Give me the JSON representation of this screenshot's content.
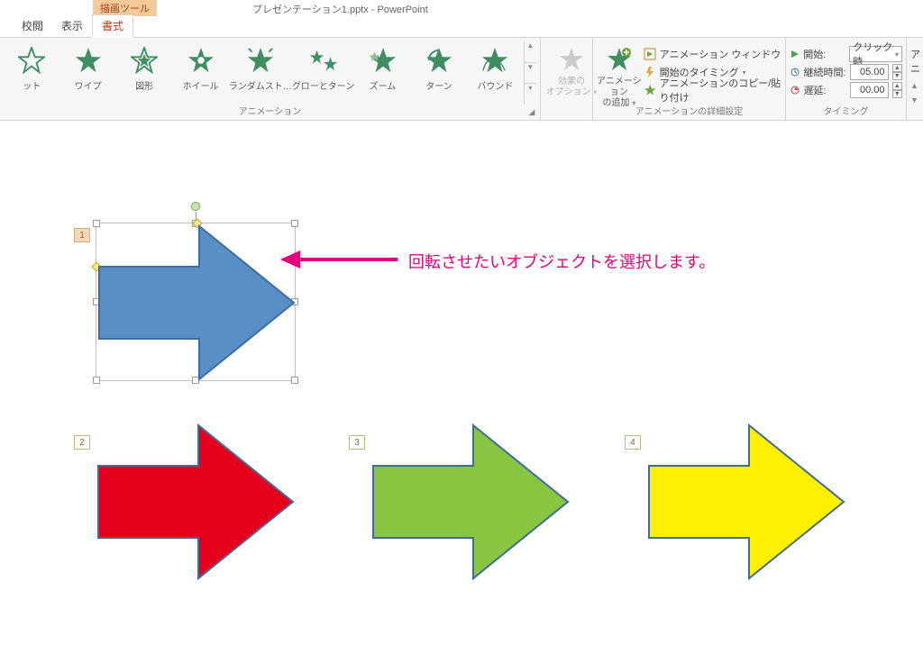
{
  "title": {
    "context_tab": "描画ツール",
    "document": "プレゼンテーション1.pptx - PowerPoint"
  },
  "tabs": {
    "review": "校閲",
    "view": "表示",
    "format": "書式"
  },
  "animation_gallery": {
    "items": [
      {
        "label": "ット"
      },
      {
        "label": "ワイプ"
      },
      {
        "label": "図形"
      },
      {
        "label": "ホイール"
      },
      {
        "label": "ランダムスト…"
      },
      {
        "label": "グローとターン"
      },
      {
        "label": "ズーム"
      },
      {
        "label": "ターン"
      },
      {
        "label": "バウンド"
      }
    ],
    "group_label": "アニメーション"
  },
  "effect_options": {
    "line1": "効果の",
    "line2": "オプション"
  },
  "advanced": {
    "add_anim_line1": "アニメーション",
    "add_anim_line2": "の追加",
    "pane": "アニメーション ウィンドウ",
    "trigger": "開始のタイミング",
    "painter": "アニメーションのコピー/貼り付け",
    "group_label": "アニメーションの詳細設定"
  },
  "timing": {
    "start_label": "開始:",
    "start_value": "クリック時",
    "duration_label": "継続時間:",
    "duration_value": "05.00",
    "delay_label": "遅延:",
    "delay_value": "00.00",
    "group_label": "タイミング",
    "reorder_label": "アニ"
  },
  "canvas": {
    "tags": {
      "t1": "1",
      "t2": "2",
      "t3": "3",
      "t4": "4"
    },
    "callout": "回転させたいオブジェクトを選択します。"
  }
}
